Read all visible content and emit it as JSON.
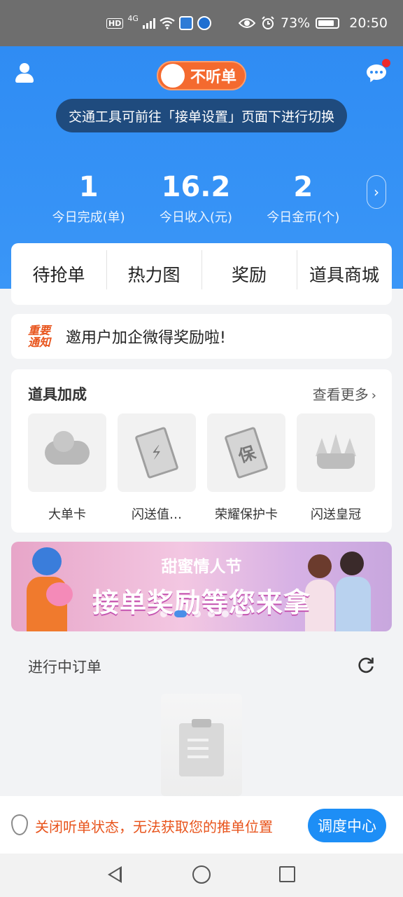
{
  "status_bar": {
    "hd_label": "HD",
    "network_label": "4G",
    "battery_percent": "73%",
    "time": "20:50"
  },
  "header": {
    "listen_toggle_label": "不听单",
    "vehicle_notice": "交通工具可前往「接单设置」页面下进行切换"
  },
  "stats": [
    {
      "value": "1",
      "label": "今日完成(单)"
    },
    {
      "value": "16.2",
      "label": "今日收入(元)"
    },
    {
      "value": "2",
      "label": "今日金币(个)"
    }
  ],
  "tabs": [
    "待抢单",
    "热力图",
    "奖励",
    "道具商城"
  ],
  "notice": {
    "badge": "重要通知",
    "text": "邀用户加企微得奖励啦!"
  },
  "props": {
    "title": "道具加成",
    "more_label": "查看更多",
    "items": [
      {
        "name": "大单卡",
        "icon": "cloud-icon"
      },
      {
        "name": "闪送值…",
        "icon": "lightning-card-icon"
      },
      {
        "name": "荣耀保护卡",
        "icon": "protect-card-icon"
      },
      {
        "name": "闪送皇冠",
        "icon": "crown-icon"
      }
    ],
    "card_glyphs": {
      "lightning": "⚡",
      "protect": "保"
    }
  },
  "banner": {
    "subtitle": "甜蜜情人节",
    "title": "接单奖励等您来拿",
    "slide_count": 6,
    "active_slide": 2
  },
  "ongoing": {
    "title": "进行中订单"
  },
  "bottom_bar": {
    "status_text": "关闭听单状态，无法获取您的推单位置",
    "dispatch_button": "调度中心"
  }
}
